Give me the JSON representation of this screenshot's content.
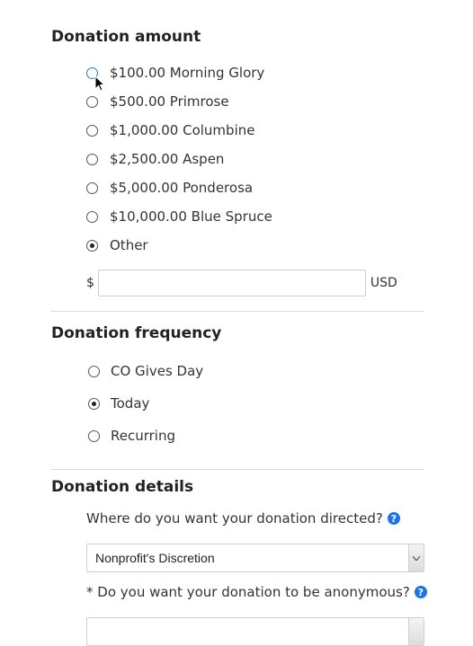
{
  "amount": {
    "title": "Donation amount",
    "options": [
      {
        "label": "$100.00 Morning Glory",
        "checked": false
      },
      {
        "label": "$500.00 Primrose",
        "checked": false
      },
      {
        "label": "$1,000.00 Columbine",
        "checked": false
      },
      {
        "label": "$2,500.00 Aspen",
        "checked": false
      },
      {
        "label": "$5,000.00 Ponderosa",
        "checked": false
      },
      {
        "label": "$10,000.00 Blue Spruce",
        "checked": false
      },
      {
        "label": "Other",
        "checked": true
      }
    ],
    "currency_symbol": "$",
    "other_value": "",
    "currency_code": "USD"
  },
  "frequency": {
    "title": "Donation frequency",
    "options": [
      {
        "label": "CO Gives Day",
        "checked": false
      },
      {
        "label": "Today",
        "checked": true
      },
      {
        "label": "Recurring",
        "checked": false
      }
    ]
  },
  "details": {
    "title": "Donation details",
    "directed_label": "Where do you want your donation directed?",
    "directed_value": "Nonprofit's Discretion",
    "anonymous_label": "* Do you want your donation to be anonymous?",
    "anonymous_value": "",
    "help_glyph": "?"
  },
  "colors": {
    "help_icon": "#1a73e8",
    "radio_hover": "#2a7ab8"
  },
  "icons": {
    "help": "question-circle-icon",
    "cursor": "mouse-pointer-icon",
    "select_arrow": "chevron-down-icon"
  }
}
